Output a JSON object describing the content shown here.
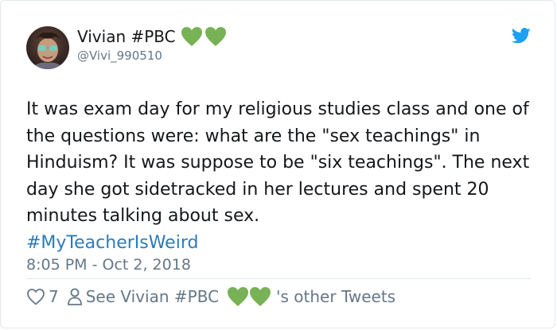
{
  "user": {
    "display_name": "Vivian #PBC",
    "handle": "@Vivi_990510",
    "name_emoji": "green-heart"
  },
  "tweet": {
    "text": "It was exam day for my religious studies class and one of the questions were: what are the \"sex teachings\" in Hinduism? It was suppose to be \"six teachings\". The next day she got sidetracked in her lectures and spent 20 minutes talking about sex.",
    "hashtag": "#MyTeacherIsWeird",
    "timestamp": "8:05 PM - Oct 2, 2018"
  },
  "actions": {
    "like_count": "7",
    "profile_prefix": "See Vivian #PBC",
    "profile_suffix": "'s other Tweets"
  },
  "colors": {
    "brand_blue": "#1da1f2",
    "link_blue": "#2b7bb9",
    "muted": "#657786",
    "heart_green": "#77b255"
  }
}
